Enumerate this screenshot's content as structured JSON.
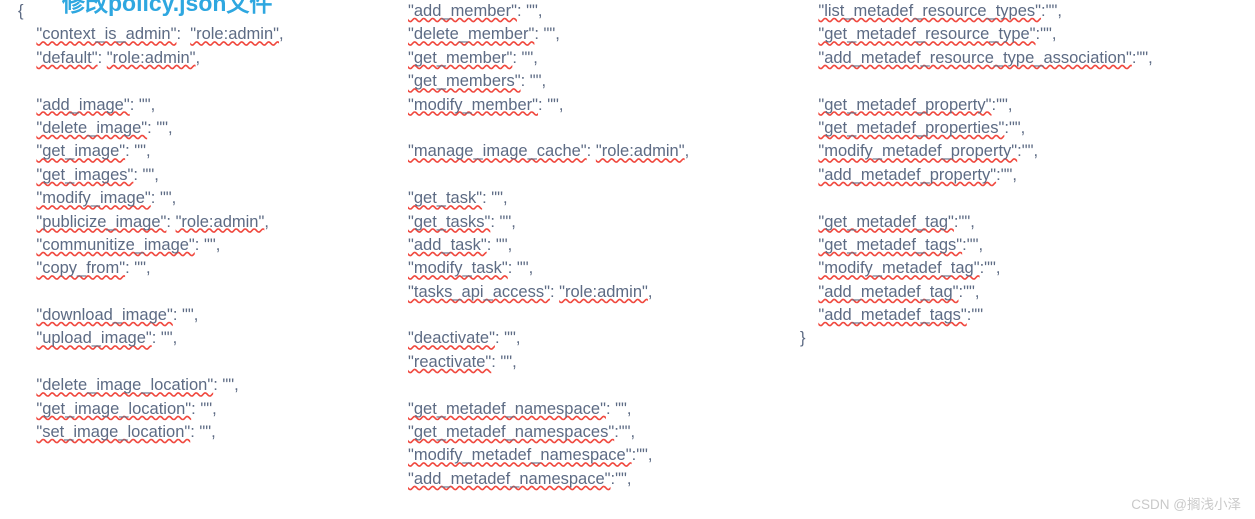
{
  "document": {
    "title": "修改policy.json文件",
    "title_color": "#2ea7e0",
    "code_color": "#5d6b84",
    "spellcheck_underline_color": "#f0483e",
    "background": "#ffffff"
  },
  "watermark": {
    "text": "CSDN @搁浅小泽",
    "color": "#c9c9c9"
  },
  "code": {
    "columns": [
      {
        "id": "left",
        "lines": [
          {
            "indent": 0,
            "key": "",
            "raw": "{"
          },
          {
            "indent": 1,
            "key": "\"context_is_admin\"",
            "sep": ":  ",
            "value": "\"role:admin\"",
            "trail": ","
          },
          {
            "indent": 1,
            "key": "\"default\"",
            "sep": ": ",
            "value": "\"role:admin\"",
            "trail": ","
          },
          {
            "indent": 1,
            "blank": true
          },
          {
            "indent": 1,
            "key": "\"add_image\"",
            "sep": ": ",
            "value": "\"\"",
            "trail": ","
          },
          {
            "indent": 1,
            "key": "\"delete_image\"",
            "sep": ": ",
            "value": "\"\"",
            "trail": ","
          },
          {
            "indent": 1,
            "key": "\"get_image\"",
            "sep": ": ",
            "value": "\"\"",
            "trail": ","
          },
          {
            "indent": 1,
            "key": "\"get_images\"",
            "sep": ": ",
            "value": "\"\"",
            "trail": ","
          },
          {
            "indent": 1,
            "key": "\"modify_image\"",
            "sep": ": ",
            "value": "\"\"",
            "trail": ","
          },
          {
            "indent": 1,
            "key": "\"publicize_image\"",
            "sep": ": ",
            "value": "\"role:admin\"",
            "trail": ","
          },
          {
            "indent": 1,
            "key": "\"communitize_image\"",
            "sep": ": ",
            "value": "\"\"",
            "trail": ","
          },
          {
            "indent": 1,
            "key": "\"copy_from\"",
            "sep": ": ",
            "value": "\"\"",
            "trail": ","
          },
          {
            "indent": 1,
            "blank": true
          },
          {
            "indent": 1,
            "key": "\"download_image\"",
            "sep": ": ",
            "value": "\"\"",
            "trail": ","
          },
          {
            "indent": 1,
            "key": "\"upload_image\"",
            "sep": ": ",
            "value": "\"\"",
            "trail": ","
          },
          {
            "indent": 1,
            "blank": true
          },
          {
            "indent": 1,
            "key": "\"delete_image_location\"",
            "sep": ": ",
            "value": "\"\"",
            "trail": ","
          },
          {
            "indent": 1,
            "key": "\"get_image_location\"",
            "sep": ": ",
            "value": "\"\"",
            "trail": ","
          },
          {
            "indent": 1,
            "key": "\"set_image_location\"",
            "sep": ": ",
            "value": "\"\"",
            "trail": ","
          }
        ]
      },
      {
        "id": "mid",
        "lines": [
          {
            "indent": 0,
            "key": "\"add_member\"",
            "sep": ": ",
            "value": "\"\"",
            "trail": ","
          },
          {
            "indent": 0,
            "key": "\"delete_member\"",
            "sep": ": ",
            "value": "\"\"",
            "trail": ","
          },
          {
            "indent": 0,
            "key": "\"get_member\"",
            "sep": ": ",
            "value": "\"\"",
            "trail": ","
          },
          {
            "indent": 0,
            "key": "\"get_members\"",
            "sep": ": ",
            "value": "\"\"",
            "trail": ","
          },
          {
            "indent": 0,
            "key": "\"modify_member\"",
            "sep": ": ",
            "value": "\"\"",
            "trail": ","
          },
          {
            "indent": 0,
            "blank": true
          },
          {
            "indent": 0,
            "key": "\"manage_image_cache\"",
            "sep": ": ",
            "value": "\"role:admin\"",
            "trail": ","
          },
          {
            "indent": 0,
            "blank": true
          },
          {
            "indent": 0,
            "key": "\"get_task\"",
            "sep": ": ",
            "value": "\"\"",
            "trail": ","
          },
          {
            "indent": 0,
            "key": "\"get_tasks\"",
            "sep": ": ",
            "value": "\"\"",
            "trail": ","
          },
          {
            "indent": 0,
            "key": "\"add_task\"",
            "sep": ": ",
            "value": "\"\"",
            "trail": ","
          },
          {
            "indent": 0,
            "key": "\"modify_task\"",
            "sep": ": ",
            "value": "\"\"",
            "trail": ","
          },
          {
            "indent": 0,
            "key": "\"tasks_api_access\"",
            "sep": ": ",
            "value": "\"role:admin\"",
            "trail": ","
          },
          {
            "indent": 0,
            "blank": true
          },
          {
            "indent": 0,
            "key": "\"deactivate\"",
            "sep": ": ",
            "value": "\"\"",
            "trail": ","
          },
          {
            "indent": 0,
            "key": "\"reactivate\"",
            "sep": ": ",
            "value": "\"\"",
            "trail": ","
          },
          {
            "indent": 0,
            "blank": true
          },
          {
            "indent": 0,
            "key": "\"get_metadef_namespace\"",
            "sep": ": ",
            "value": "\"\"",
            "trail": ","
          },
          {
            "indent": 0,
            "key": "\"get_metadef_namespaces\"",
            "sep": ":",
            "value": "\"\"",
            "trail": ","
          },
          {
            "indent": 0,
            "key": "\"modify_metadef_namespace\"",
            "sep": ":",
            "value": "\"\"",
            "trail": ","
          },
          {
            "indent": 0,
            "key": "\"add_metadef_namespace\"",
            "sep": ":",
            "value": "\"\"",
            "trail": ","
          }
        ]
      },
      {
        "id": "right",
        "lines": [
          {
            "indent": 1,
            "key": "\"list_metadef_resource_types\"",
            "sep": ":",
            "value": "\"\"",
            "trail": ","
          },
          {
            "indent": 1,
            "key": "\"get_metadef_resource_type\"",
            "sep": ":",
            "value": "\"\"",
            "trail": ","
          },
          {
            "indent": 1,
            "key": "\"add_metadef_resource_type_association\"",
            "sep": ":",
            "value": "\"\"",
            "trail": ","
          },
          {
            "indent": 1,
            "blank": true
          },
          {
            "indent": 1,
            "key": "\"get_metadef_property\"",
            "sep": ":",
            "value": "\"\"",
            "trail": ","
          },
          {
            "indent": 1,
            "key": "\"get_metadef_properties\"",
            "sep": ":",
            "value": "\"\"",
            "trail": ","
          },
          {
            "indent": 1,
            "key": "\"modify_metadef_property\"",
            "sep": ":",
            "value": "\"\"",
            "trail": ","
          },
          {
            "indent": 1,
            "key": "\"add_metadef_property\"",
            "sep": ":",
            "value": "\"\"",
            "trail": ","
          },
          {
            "indent": 1,
            "blank": true
          },
          {
            "indent": 1,
            "key": "\"get_metadef_tag\"",
            "sep": ":",
            "value": "\"\"",
            "trail": ","
          },
          {
            "indent": 1,
            "key": "\"get_metadef_tags\"",
            "sep": ":",
            "value": "\"\"",
            "trail": ","
          },
          {
            "indent": 1,
            "key": "\"modify_metadef_tag\"",
            "sep": ":",
            "value": "\"\"",
            "trail": ","
          },
          {
            "indent": 1,
            "key": "\"add_metadef_tag\"",
            "sep": ":",
            "value": "\"\"",
            "trail": ","
          },
          {
            "indent": 1,
            "key": "\"add_metadef_tags\"",
            "sep": ":",
            "value": "\"\"",
            "trail": ""
          },
          {
            "indent": 0,
            "key": "",
            "raw": "}"
          }
        ]
      }
    ]
  }
}
